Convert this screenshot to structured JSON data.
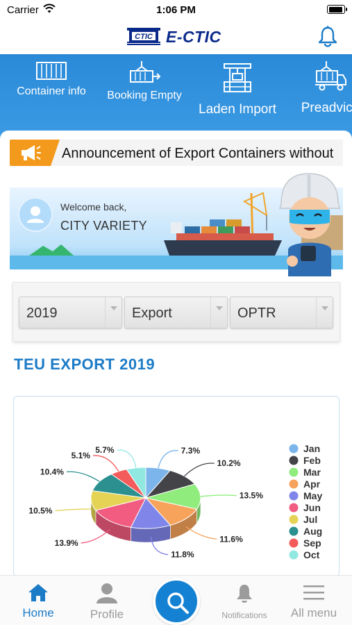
{
  "status_bar": {
    "carrier": "Carrier",
    "time": "1:06 PM"
  },
  "header": {
    "logo_badge": "CTIC",
    "logo_text": "E-CTIC"
  },
  "quick_actions": [
    {
      "label": "Container info",
      "icon": "container-icon"
    },
    {
      "label": "Booking Empty",
      "icon": "crane-lift-icon"
    },
    {
      "label": "Laden Import",
      "icon": "port-crane-icon"
    },
    {
      "label": "Preadvice",
      "icon": "truck-crane-icon"
    }
  ],
  "announcement": {
    "text": "Announcement of Export Containers without"
  },
  "welcome": {
    "greeting": "Welcome back,",
    "name": "CITY VARIETY"
  },
  "filters": {
    "year": "2019",
    "type": "Export",
    "operator": "OPTR"
  },
  "section_title": "TEU EXPORT 2019",
  "chart_data": {
    "type": "pie",
    "title": "",
    "legend_position": "right",
    "categories": [
      "Jan",
      "Feb",
      "Mar",
      "Apr",
      "May",
      "Jun",
      "Jul",
      "Aug",
      "Sep",
      "Oct"
    ],
    "values": [
      7.3,
      10.2,
      13.5,
      11.6,
      11.8,
      13.9,
      10.5,
      10.4,
      5.1,
      5.7
    ],
    "labels": [
      "7.3%",
      "10.2%",
      "13.5%",
      "11.6%",
      "11.8%",
      "13.9%",
      "10.5%",
      "10.4%",
      "5.1%",
      "5.7%"
    ],
    "colors": [
      "#7cb5ec",
      "#434348",
      "#90ed7d",
      "#f7a35c",
      "#8085e9",
      "#f15c80",
      "#e4d354",
      "#2b908f",
      "#f45b5b",
      "#91e8e1"
    ]
  },
  "tabs": [
    {
      "label": "Home",
      "icon": "home-icon",
      "active": true
    },
    {
      "label": "Profile",
      "icon": "profile-icon",
      "active": false
    },
    {
      "label": "",
      "icon": "search-icon",
      "active": false
    },
    {
      "label": "Notifications",
      "icon": "bell-icon",
      "active": false
    },
    {
      "label": "All menu",
      "icon": "hamburger-menu-icon",
      "active": false
    }
  ],
  "colors": {
    "primary": "#1b7bc7",
    "header_band": "#3c9be4",
    "announcement_tag": "#f39a1c",
    "logo": "#0a2a8a"
  }
}
